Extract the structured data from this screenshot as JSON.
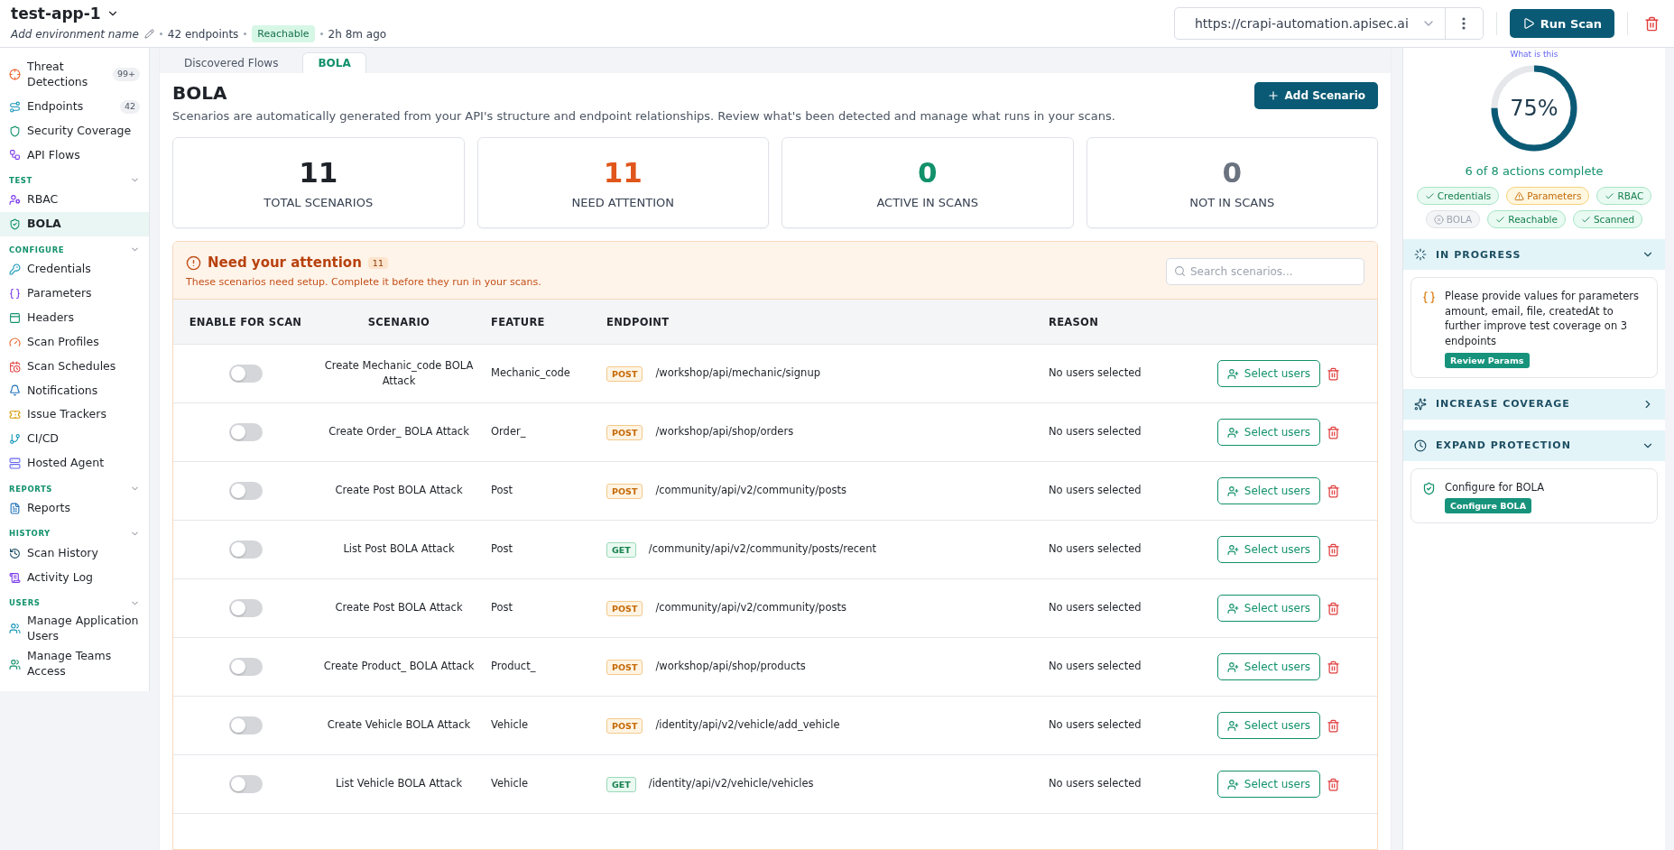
{
  "header": {
    "app_name": "test-app-1",
    "environment_placeholder": "Add environment name",
    "endpoints": "42 endpoints",
    "status": "Reachable",
    "last_seen": "2h 8m ago",
    "url": "https://crapi-automation.apisec.ai",
    "run_button": "Run Scan"
  },
  "sidebar": {
    "items": [
      {
        "label": "Threat Detections",
        "badge": "99+",
        "selected": false
      },
      {
        "label": "Endpoints",
        "badge": "42",
        "selected": false
      },
      {
        "label": "Security Coverage",
        "selected": false
      },
      {
        "label": "API Flows",
        "selected": false
      }
    ],
    "sections": [
      {
        "title": "TEST",
        "expanded": true,
        "items": [
          {
            "label": "RBAC",
            "selected": false
          },
          {
            "label": "BOLA",
            "selected": true
          }
        ]
      },
      {
        "title": "CONFIGURE",
        "expanded": true,
        "items": [
          {
            "label": "Credentials",
            "selected": false
          },
          {
            "label": "Parameters",
            "selected": false
          },
          {
            "label": "Headers",
            "selected": false
          },
          {
            "label": "Scan Profiles",
            "selected": false
          },
          {
            "label": "Scan Schedules",
            "selected": false
          },
          {
            "label": "Notifications",
            "selected": false
          },
          {
            "label": "Issue Trackers",
            "selected": false
          },
          {
            "label": "CI/CD",
            "selected": false
          },
          {
            "label": "Hosted Agent",
            "selected": false
          }
        ]
      },
      {
        "title": "REPORTS",
        "expanded": true,
        "items": [
          {
            "label": "Reports",
            "selected": false
          }
        ]
      },
      {
        "title": "HISTORY",
        "expanded": true,
        "items": [
          {
            "label": "Scan History",
            "selected": false
          },
          {
            "label": "Activity Log",
            "selected": false
          }
        ]
      },
      {
        "title": "USERS",
        "expanded": true,
        "items": [
          {
            "label": "Manage Application Users",
            "selected": false
          },
          {
            "label": "Manage Teams Access",
            "selected": false
          }
        ]
      }
    ]
  },
  "tabs": [
    {
      "label": "Discovered Flows",
      "selected": false
    },
    {
      "label": "BOLA",
      "selected": true
    }
  ],
  "page": {
    "title": "BOLA",
    "description": "Scenarios are automatically generated from your API's structure and endpoint relationships. Review what's been detected and manage what runs in your scans.",
    "add_button": "Add Scenario"
  },
  "stats": [
    {
      "value": "11",
      "label": "TOTAL SCENARIOS",
      "color": "#1f2329"
    },
    {
      "value": "11",
      "label": "NEED ATTENTION",
      "color": "#e0561b"
    },
    {
      "value": "0",
      "label": "ACTIVE IN SCANS",
      "color": "#12916b"
    },
    {
      "value": "0",
      "label": "NOT IN SCANS",
      "color": "#6b7280"
    }
  ],
  "attention": {
    "title": "Need your attention",
    "count": "11",
    "subtitle": "These scenarios need setup. Complete it before they run in your scans.",
    "search_placeholder": "Search scenarios..."
  },
  "table": {
    "columns": [
      "ENABLE FOR SCAN",
      "SCENARIO",
      "FEATURE",
      "ENDPOINT",
      "REASON"
    ],
    "rows": [
      {
        "enabled": false,
        "scenario": "Create Mechanic_code BOLA Attack",
        "feature": "Mechanic_code",
        "method": "POST",
        "endpoint": "/workshop/api/mechanic/signup",
        "reason": "No users selected",
        "action": "Select users"
      },
      {
        "enabled": false,
        "scenario": "Create Order_ BOLA Attack",
        "feature": "Order_",
        "method": "POST",
        "endpoint": "/workshop/api/shop/orders",
        "reason": "No users selected",
        "action": "Select users"
      },
      {
        "enabled": false,
        "scenario": "Create Post BOLA Attack",
        "feature": "Post",
        "method": "POST",
        "endpoint": "/community/api/v2/community/posts",
        "reason": "No users selected",
        "action": "Select users"
      },
      {
        "enabled": false,
        "scenario": "List Post BOLA Attack",
        "feature": "Post",
        "method": "GET",
        "endpoint": "/community/api/v2/community/posts/recent",
        "reason": "No users selected",
        "action": "Select users"
      },
      {
        "enabled": false,
        "scenario": "Create Post BOLA Attack",
        "feature": "Post",
        "method": "POST",
        "endpoint": "/community/api/v2/community/posts",
        "reason": "No users selected",
        "action": "Select users"
      },
      {
        "enabled": false,
        "scenario": "Create Product_ BOLA Attack",
        "feature": "Product_",
        "method": "POST",
        "endpoint": "/workshop/api/shop/products",
        "reason": "No users selected",
        "action": "Select users"
      },
      {
        "enabled": false,
        "scenario": "Create Vehicle BOLA Attack",
        "feature": "Vehicle",
        "method": "POST",
        "endpoint": "/identity/api/v2/vehicle/add_vehicle",
        "reason": "No users selected",
        "action": "Select users"
      },
      {
        "enabled": false,
        "scenario": "List Vehicle BOLA Attack",
        "feature": "Vehicle",
        "method": "GET",
        "endpoint": "/identity/api/v2/vehicle/vehicles",
        "reason": "No users selected",
        "action": "Select users"
      }
    ]
  },
  "progress": {
    "help_link": "What is this",
    "level": 0.75,
    "percent": "75%",
    "summary": "6 of 8 actions complete",
    "checks": [
      {
        "label": "Credentials",
        "kind": "done"
      },
      {
        "label": "Parameters",
        "kind": "warning"
      },
      {
        "label": "RBAC",
        "kind": "done"
      },
      {
        "label": "BOLA",
        "kind": "failed"
      },
      {
        "label": "Reachable",
        "kind": "done"
      },
      {
        "label": "Scanned",
        "kind": "done"
      }
    ]
  },
  "panels": [
    {
      "title": "IN PROGRESS",
      "expanded": true,
      "kind": "progress",
      "cards": [
        {
          "text": "Please provide values for parameters amount, email, file, createdAt to further improve test coverage on 3 endpoints",
          "button": "Review Params"
        }
      ]
    },
    {
      "title": "INCREASE COVERAGE",
      "expanded": false,
      "kind": "coverage"
    },
    {
      "title": "EXPAND PROTECTION",
      "expanded": true,
      "kind": "protection",
      "cards": [
        {
          "text": "Configure for BOLA",
          "button": "Configure BOLA"
        }
      ]
    }
  ]
}
